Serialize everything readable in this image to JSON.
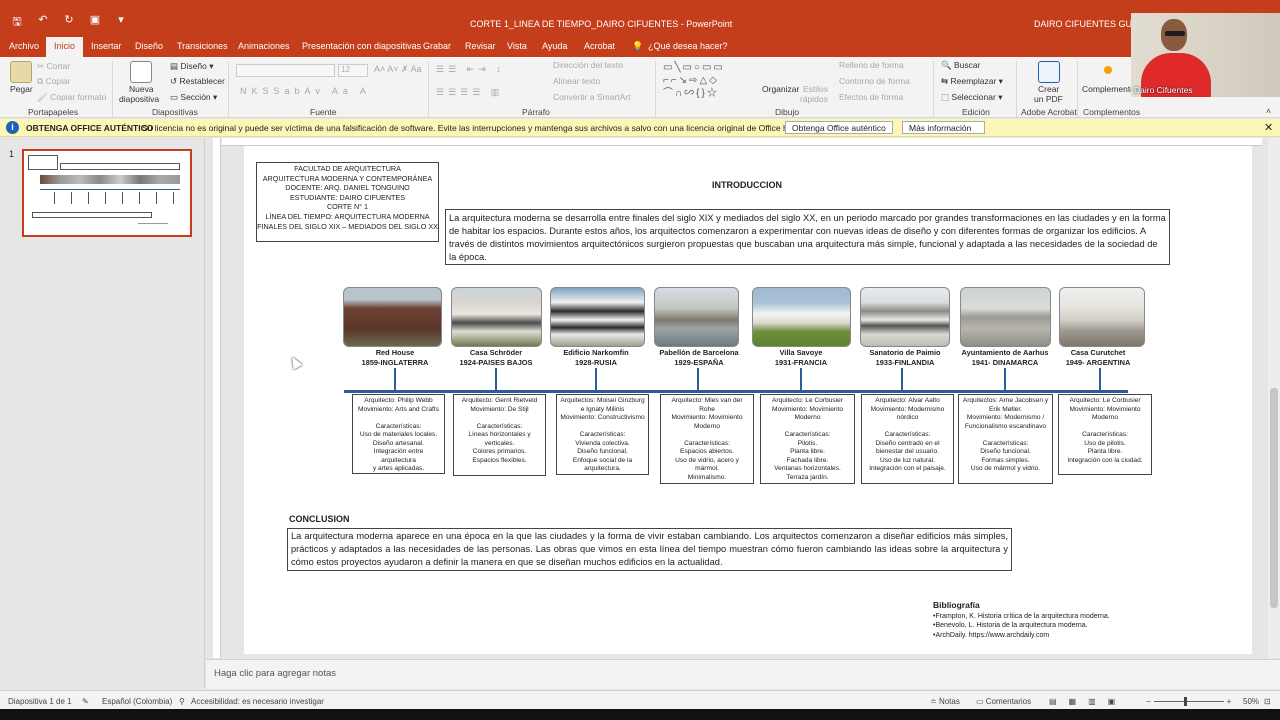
{
  "window": {
    "title": "CORTE 1_LINEA DE TIEMPO_DAIRO CIFUENTES  -  PowerPoint",
    "user": "DAIRO CIFUENTES GUERRA"
  },
  "tabs": [
    "Archivo",
    "Inicio",
    "Insertar",
    "Diseño",
    "Transiciones",
    "Animaciones",
    "Presentación con diapositivas",
    "Grabar",
    "Revisar",
    "Vista",
    "Ayuda",
    "Acrobat"
  ],
  "tell_me": "¿Qué desea hacer?",
  "ribbon": {
    "clipboard": {
      "paste": "Pegar",
      "cut": "Cortar",
      "copy": "Copiar",
      "format": "Copiar formato",
      "label": "Portapapeles"
    },
    "slides": {
      "new": "Nueva",
      "new2": "diapositiva",
      "layout": "Diseño",
      "reset": "Restablecer",
      "section": "Sección",
      "label": "Diapositivas"
    },
    "font": {
      "size": "12",
      "label": "Fuente"
    },
    "paragraph": {
      "dir": "Dirección del texto",
      "align": "Alinear texto",
      "smartart": "Convertir a SmartArt",
      "label": "Párrafo"
    },
    "drawing": {
      "arrange": "Organizar",
      "styles": "Estilos",
      "styles2": "rápidos",
      "fill": "Relleno de forma",
      "outline": "Contorno de forma",
      "effects": "Efectos de forma",
      "label": "Dibujo"
    },
    "editing": {
      "find": "Buscar",
      "replace": "Reemplazar",
      "select": "Seleccionar",
      "label": "Edición"
    },
    "acrobat": {
      "create": "Crear",
      "pdf": "un PDF",
      "label": "Adobe Acrobat"
    },
    "addins": {
      "name": "Complementos",
      "label": "Complementos"
    }
  },
  "notification": {
    "title": "OBTENGA OFFICE AUTÉNTICO",
    "message": "Su licencia no es original y puede ser víctima de una falsificación de software. Evite las interrupciones y mantenga sus archivos a salvo con una licencia original de Office hoy mismo.",
    "btn1": "Obtenga Office auténtico",
    "btn2": "Más información"
  },
  "thumb_number": "1",
  "slide": {
    "header_lines": [
      "FACULTAD DE ARQUITECTURA",
      "ARQUITECTURA MODERNA Y CONTEMPORÁNEA",
      "DOCENTE: ARQ. DANIEL TONGUINO",
      "ESTUDIANTE: DAIRO CIFUENTES",
      "CORTE N° 1",
      "LÍNEA DEL TIEMPO: ARQUITECTURA MODERNA",
      "FINALES DEL SIGLO XIX – MEDIADOS DEL SIGLO XX"
    ],
    "intro_title": "INTRODUCCION",
    "intro_text": "La arquitectura moderna se desarrolla entre finales del siglo XIX y mediados del siglo XX, en un periodo marcado por grandes transformaciones en las ciudades y en la forma de habitar los espacios. Durante estos años, los arquitectos comenzaron a experimentar con nuevas ideas de diseño y con diferentes formas de organizar los edificios. A través de distintos movimientos arquitectónicos surgieron propuestas que buscaban una arquitectura más simple, funcional y adaptada a las necesidades de la sociedad de la época.",
    "buildings": [
      {
        "name": "Red House",
        "date": "1859-INGLATERRA",
        "card": [
          "Arquitecto: Philip Webb",
          "Movimiento: Arts and Crafts",
          "",
          "Características:",
          "Uso de materiales locales.",
          "Diseño artesanal.",
          "Integración entre",
          "arquitectura",
          "y artes aplicadas."
        ]
      },
      {
        "name": "Casa Schröder",
        "date": "1924-PAISES BAJOS",
        "card": [
          "Arquitecto: Gerrit Rietveld",
          "Movimiento: De Stijl",
          "",
          "Características:",
          "Líneas horizontales y",
          "verticales.",
          "Colores primarios.",
          "Espacios flexibles."
        ]
      },
      {
        "name": "Edificio Narkomfin",
        "date": "1928-RUSIA",
        "card": [
          "Arquitectos: Moisei Ginzburg",
          "e Ignaty Milinis",
          "Movimiento: Constructivismo",
          "",
          "Características:",
          "Vivienda colectiva.",
          "Diseño funcional.",
          "Enfoque social de la",
          "arquitectura."
        ]
      },
      {
        "name": "Pabellón de Barcelona",
        "date": "1929-ESPAÑA",
        "card": [
          "Arquitecto: Mies van der",
          "Rohe",
          "Movimiento: Movimiento",
          "Moderno",
          "",
          "Características:",
          "Espacios abiertos.",
          "Uso de vidrio, acero y",
          "mármol.",
          "Minimalismo."
        ]
      },
      {
        "name": "Villa Savoye",
        "date": "1931-FRANCIA",
        "card": [
          "Arquitecto: Le Corbusier",
          "Movimiento: Movimiento",
          "Moderno",
          "",
          "Características:",
          "Pilotis.",
          "Planta libre.",
          "Fachada libre.",
          "Ventanas horizontales.",
          "Terraza jardín."
        ]
      },
      {
        "name": "Sanatorio de Paimio",
        "date": "1933-FINLANDIA",
        "card": [
          "Arquitecto: Alvar Aalto",
          "Movimiento: Modernismo",
          "nórdico",
          "",
          "Características:",
          "Diseño centrado en el",
          "bienestar del usuario.",
          "Uso de luz natural.",
          "Integración con el paisaje."
        ]
      },
      {
        "name": "Ayuntamiento de Aarhus",
        "date": "1941- DINAMARCA",
        "card": [
          "Arquitectos: Arne Jacobsen y",
          "Erik Møller.",
          "Movimiento: Modernismo /",
          "Funcionalismo escandinavo",
          "",
          "Características:",
          "Diseño funcional.",
          "Formas simples.",
          "Uso de mármol y vidrio."
        ]
      },
      {
        "name": "Casa Curutchet",
        "date": "1949- ARGENTINA",
        "card": [
          "Arquitecto: Le Corbusier",
          "Movimiento: Movimiento",
          "Moderno",
          "",
          "Características:",
          "Uso de pilotis.",
          "Planta libre.",
          "Integración con la ciudad."
        ]
      }
    ],
    "conclusion_title": "CONCLUSION",
    "conclusion_text": "La arquitectura moderna aparece en una época en la que las ciudades y la forma de vivir estaban cambiando. Los arquitectos comenzaron a diseñar edificios más simples, prácticos y adaptados a las necesidades de las personas. Las obras que vimos en esta línea del tiempo muestran cómo fueron cambiando las ideas sobre la arquitectura y cómo estos proyectos ayudaron a definir la manera en que se diseñan muchos edificios en la actualidad.",
    "bibliography_title": "Bibliografía",
    "bibliography": [
      "•Frampton, K. Historia crítica de la arquitectura moderna.",
      "•Benevolo, L. Historia de la arquitectura moderna.",
      "•ArchDaily. https://www.archdaily.com"
    ]
  },
  "notes_placeholder": "Haga clic para agregar notas",
  "status": {
    "slide": "Diapositiva 1 de 1",
    "language": "Español (Colombia)",
    "accessibility": "Accesibilidad: es necesario investigar",
    "notes": "Notas",
    "comments": "Comentarios",
    "zoom": "50%"
  },
  "webcam_name": "Dairo Cifuentes",
  "colors": {
    "accent": "#c43e1c",
    "timeline": "#2e5b99",
    "notification": "#fcf7b6"
  }
}
